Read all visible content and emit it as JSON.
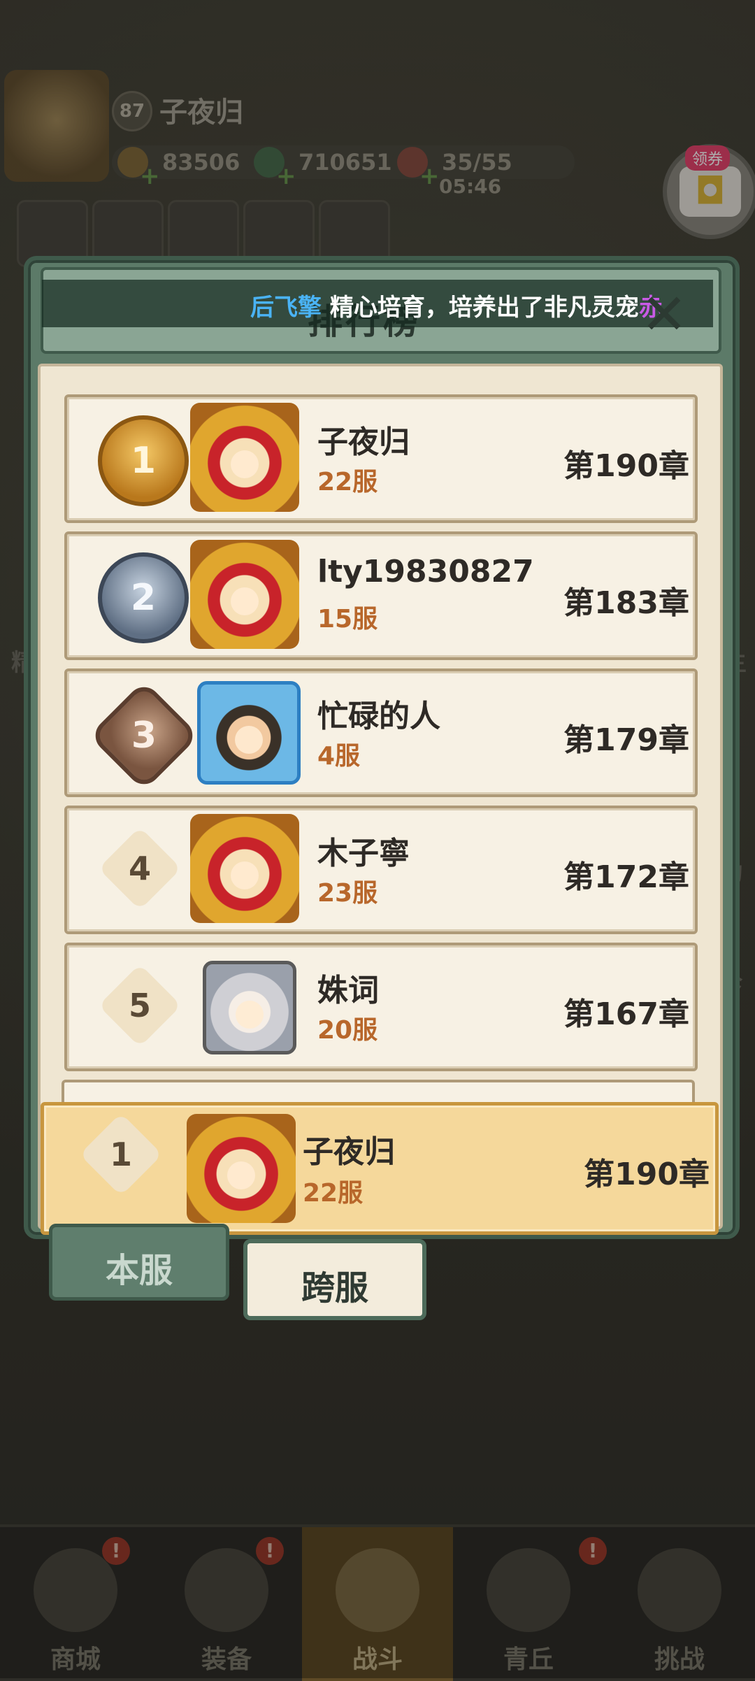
{
  "player": {
    "level": "87",
    "name": "子夜归",
    "gold": "83506",
    "jade": "710651",
    "stamina": "35/55",
    "stamina_timer": "05:46"
  },
  "coupon": {
    "label": "领券"
  },
  "panel": {
    "title": "排行榜",
    "ticker": {
      "name": "后飞擎",
      "message": " 精心培育，培养出了非凡灵宠",
      "pet": "赤"
    }
  },
  "rankings": [
    {
      "rank": "1",
      "name": "子夜归",
      "server": "22服",
      "chapter": "第190章"
    },
    {
      "rank": "2",
      "name": "lty19830827",
      "server": "15服",
      "chapter": "第183章"
    },
    {
      "rank": "3",
      "name": "忙碌的人",
      "server": "4服",
      "chapter": "第179章"
    },
    {
      "rank": "4",
      "name": "木子寧",
      "server": "23服",
      "chapter": "第172章"
    },
    {
      "rank": "5",
      "name": "姝词",
      "server": "20服",
      "chapter": "第167章"
    }
  ],
  "self": {
    "rank": "1",
    "name": "子夜归",
    "server": "22服",
    "chapter": "第190章"
  },
  "tabs": {
    "local": "本服",
    "cross": "跨服"
  },
  "nav": {
    "shop": "商城",
    "equip": "装备",
    "battle": "战斗",
    "hill": "青丘",
    "challenge": "挑战"
  },
  "side_labels": {
    "left_a": "精",
    "right_a": "主",
    "right_b": "动",
    "right_c": "珍"
  },
  "colors": {
    "ticker_name": "#4ab3f5",
    "ticker_pet": "#c85ae6",
    "server_text": "#b8672b"
  }
}
